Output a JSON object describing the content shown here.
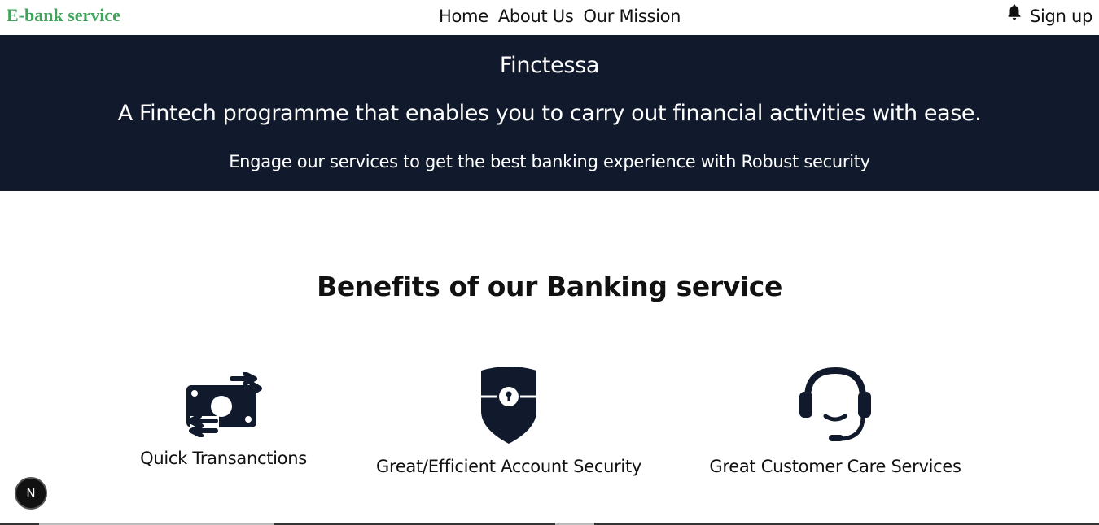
{
  "header": {
    "brand": "E-bank service",
    "nav": [
      "Home",
      "About Us",
      "Our Mission"
    ],
    "signup_label": "Sign up",
    "bell_icon": "bell-icon"
  },
  "hero": {
    "name": "Finctessa",
    "tagline": "A Fintech programme that enables you to carry out financial activities with ease.",
    "subtext": "Engage our services to get the best banking experience with Robust security"
  },
  "benefits": {
    "title": "Benefits of our Banking service",
    "items": [
      {
        "label": "Quick Transanctions",
        "icon": "money-transfer-icon"
      },
      {
        "label": "Great/Efficient Account Security",
        "icon": "shield-lock-icon"
      },
      {
        "label": "Great Customer Care Services",
        "icon": "headset-icon"
      }
    ]
  },
  "dev_badge": "N",
  "colors": {
    "brand_green": "#3fa45b",
    "hero_bg": "#101a2c",
    "icon_dark": "#101a2c"
  }
}
